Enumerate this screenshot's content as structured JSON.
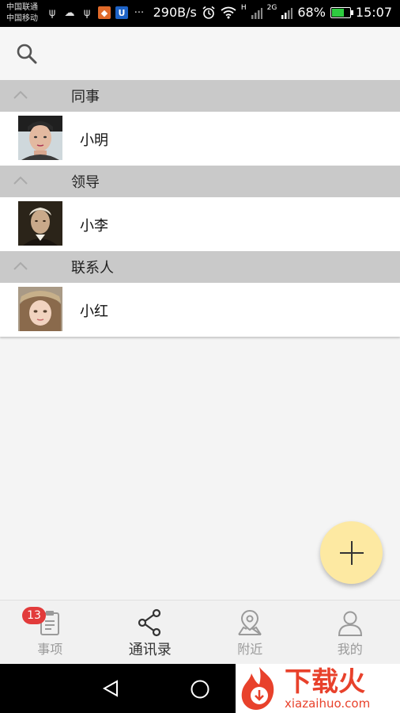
{
  "status_bar": {
    "carrier_1": "中国联通",
    "carrier_2": "中国移动",
    "speed": "290B/s",
    "signal_label_h": "H",
    "signal_label_2g": "2G",
    "battery": "68%",
    "battery_level": 0.68,
    "time": "15:07",
    "more": "···"
  },
  "search": {
    "icon": "search-icon"
  },
  "groups": [
    {
      "title": "同事",
      "contacts": [
        {
          "name": "小明"
        }
      ]
    },
    {
      "title": "领导",
      "contacts": [
        {
          "name": "小李"
        }
      ]
    },
    {
      "title": "联系人",
      "contacts": [
        {
          "name": "小红"
        }
      ]
    }
  ],
  "fab": {
    "icon": "plus-icon",
    "color": "#fde9a2"
  },
  "tabs": [
    {
      "label": "事项",
      "icon": "clipboard-icon",
      "badge": "13"
    },
    {
      "label": "通讯录",
      "icon": "share-icon",
      "active": true
    },
    {
      "label": "附近",
      "icon": "map-pin-icon"
    },
    {
      "label": "我的",
      "icon": "person-icon"
    }
  ],
  "watermark": {
    "title": "下载火",
    "subtitle": "xiazaihuo.com"
  },
  "colors": {
    "badge": "#e23b3b",
    "group_header": "#c9c9c9",
    "watermark": "#e8412b"
  }
}
